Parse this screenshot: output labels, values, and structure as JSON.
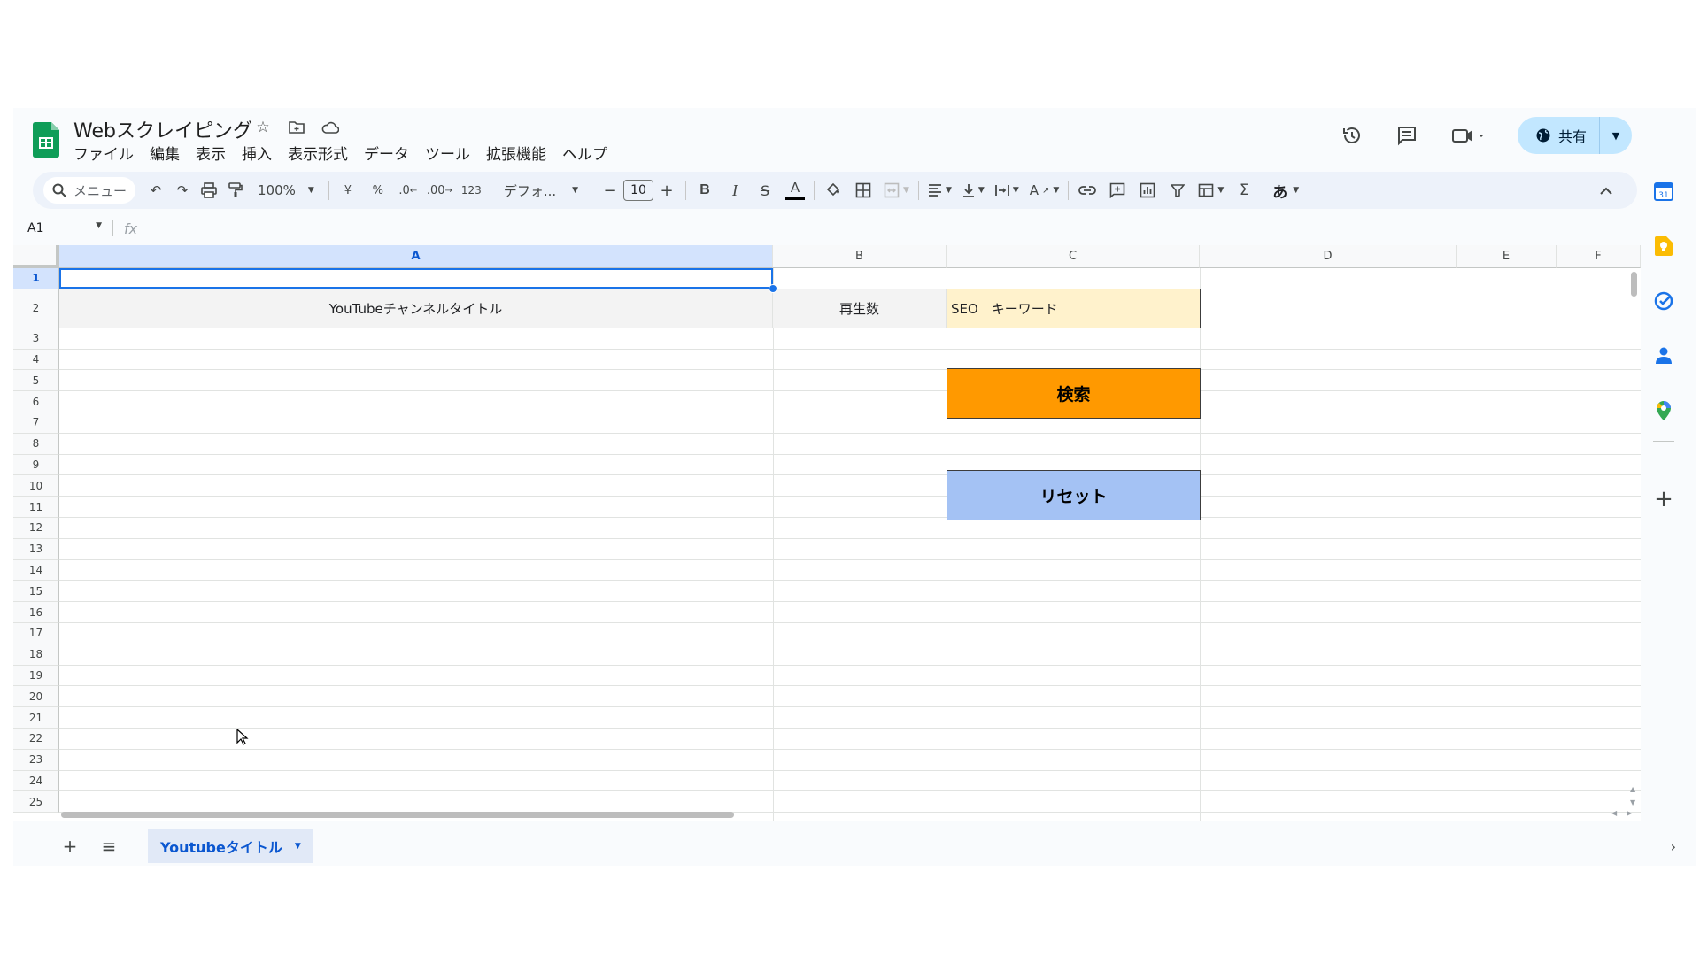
{
  "doc": {
    "title": "Webスクレイピング"
  },
  "menu": [
    "ファイル",
    "編集",
    "表示",
    "挿入",
    "表示形式",
    "データ",
    "ツール",
    "拡張機能",
    "ヘルプ"
  ],
  "share": {
    "label": "共有"
  },
  "toolbar": {
    "search_label": "メニュー",
    "zoom": "100%",
    "currency": "¥",
    "percent": "%",
    "dec_decrease": ".0",
    "dec_increase": ".00",
    "number_format": "123",
    "font": "デフォ...",
    "font_size": "10",
    "ime_label": "あ"
  },
  "formula_bar": {
    "name_box": "A1",
    "fx": "fx"
  },
  "columns": [
    "A",
    "B",
    "C",
    "D",
    "E",
    "F"
  ],
  "rows": [
    "1",
    "2",
    "3",
    "4",
    "5",
    "6",
    "7",
    "8",
    "9",
    "10",
    "11",
    "12",
    "13",
    "14",
    "15",
    "16",
    "17",
    "18",
    "19",
    "20",
    "21",
    "22",
    "23",
    "24",
    "25"
  ],
  "cells": {
    "a2": "YouTubeチャンネルタイトル",
    "b2": "再生数",
    "c2": "SEO　キーワード"
  },
  "buttons": {
    "search": "検索",
    "reset": "リセット"
  },
  "sheet": {
    "tab_name": "Youtubeタイトル"
  },
  "colors": {
    "search_button": "#ff9900",
    "reset_button": "#a4c2f4",
    "keyword_cell": "#fff2cc",
    "header_row": "#f3f3f3",
    "accent": "#0b57d0"
  }
}
